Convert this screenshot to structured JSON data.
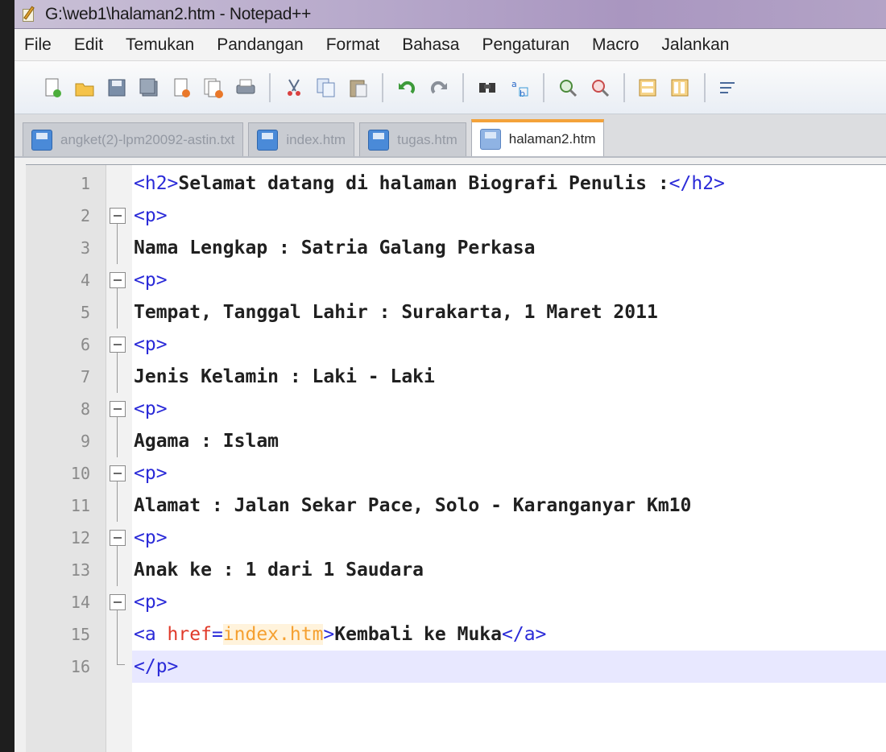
{
  "window": {
    "title": "G:\\web1\\halaman2.htm - Notepad++"
  },
  "menu": [
    "File",
    "Edit",
    "Temukan",
    "Pandangan",
    "Format",
    "Bahasa",
    "Pengaturan",
    "Macro",
    "Jalankan"
  ],
  "toolbar": {
    "groups": [
      [
        "new-file-icon",
        "open-folder-icon",
        "save-icon",
        "save-all-icon",
        "close-file-icon",
        "close-all-icon",
        "print-icon"
      ],
      [
        "cut-icon",
        "copy-icon",
        "paste-icon"
      ],
      [
        "undo-icon",
        "redo-icon"
      ],
      [
        "find-icon",
        "replace-icon"
      ],
      [
        "zoom-in-icon",
        "zoom-out-icon"
      ],
      [
        "sync-vertical-icon",
        "sync-horizontal-icon"
      ],
      [
        "word-wrap-icon"
      ]
    ]
  },
  "tabs": [
    {
      "label": "angket(2)-lpm20092-astin.txt",
      "active": false
    },
    {
      "label": "index.htm",
      "active": false
    },
    {
      "label": "tugas.htm",
      "active": false
    },
    {
      "label": "halaman2.htm",
      "active": true
    }
  ],
  "editor": {
    "current_line": 16,
    "lines": [
      {
        "n": "1",
        "fold": "none",
        "parts": [
          [
            "tag",
            "<h2>"
          ],
          [
            "text",
            "Selamat datang di halaman Biografi Penulis :"
          ],
          [
            "tag",
            "</h2>"
          ]
        ]
      },
      {
        "n": "2",
        "fold": "box",
        "parts": [
          [
            "tag",
            "<p>"
          ]
        ]
      },
      {
        "n": "3",
        "fold": "line",
        "parts": [
          [
            "text",
            "Nama Lengkap : Satria Galang Perkasa"
          ]
        ]
      },
      {
        "n": "4",
        "fold": "box",
        "parts": [
          [
            "tag",
            "<p>"
          ]
        ]
      },
      {
        "n": "5",
        "fold": "line",
        "parts": [
          [
            "text",
            "Tempat, Tanggal Lahir : Surakarta, 1 Maret 2011"
          ]
        ]
      },
      {
        "n": "6",
        "fold": "box",
        "parts": [
          [
            "tag",
            "<p>"
          ]
        ]
      },
      {
        "n": "7",
        "fold": "line",
        "parts": [
          [
            "text",
            "Jenis Kelamin : Laki - Laki"
          ]
        ]
      },
      {
        "n": "8",
        "fold": "box",
        "parts": [
          [
            "tag",
            "<p>"
          ]
        ]
      },
      {
        "n": "9",
        "fold": "line",
        "parts": [
          [
            "text",
            "Agama : Islam"
          ]
        ]
      },
      {
        "n": "10",
        "fold": "box",
        "parts": [
          [
            "tag",
            "<p>"
          ]
        ]
      },
      {
        "n": "11",
        "fold": "line",
        "parts": [
          [
            "text",
            "Alamat : Jalan Sekar Pace, Solo - Karanganyar Km10"
          ]
        ]
      },
      {
        "n": "12",
        "fold": "box",
        "parts": [
          [
            "tag",
            "<p>"
          ]
        ]
      },
      {
        "n": "13",
        "fold": "line",
        "parts": [
          [
            "text",
            "Anak ke : 1 dari 1 Saudara"
          ]
        ]
      },
      {
        "n": "14",
        "fold": "box",
        "parts": [
          [
            "tag",
            "<p>"
          ]
        ]
      },
      {
        "n": "15",
        "fold": "line",
        "parts": [
          [
            "tag",
            "<a "
          ],
          [
            "attr",
            "href"
          ],
          [
            "eq",
            "="
          ],
          [
            "val",
            "index.htm"
          ],
          [
            "tag",
            ">"
          ],
          [
            "text",
            "Kembali ke Muka"
          ],
          [
            "tag",
            "</a>"
          ]
        ]
      },
      {
        "n": "16",
        "fold": "end",
        "parts": [
          [
            "tag",
            "</p>"
          ]
        ]
      }
    ]
  }
}
